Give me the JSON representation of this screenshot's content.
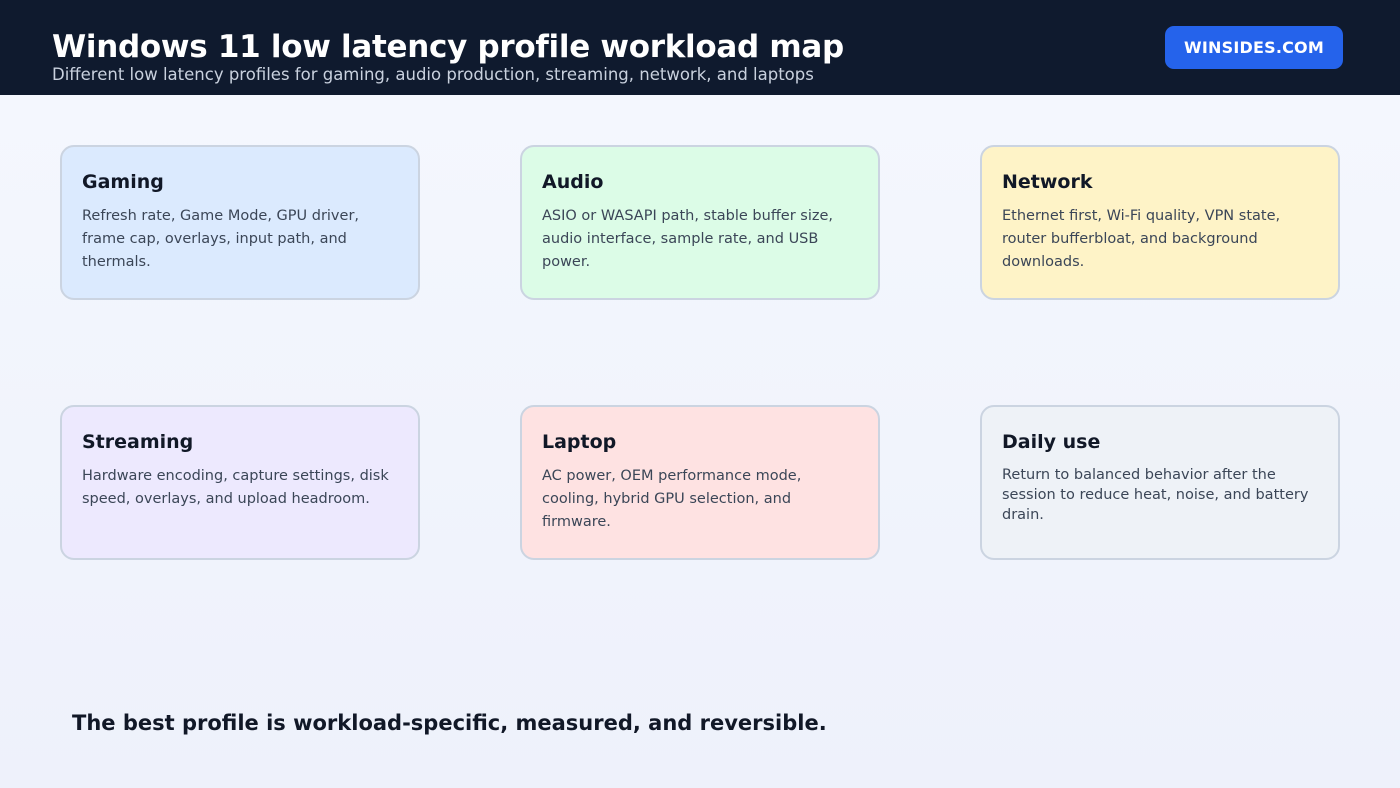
{
  "header": {
    "title": "Windows 11 low latency profile workload map",
    "subtitle": "Different low latency profiles for gaming, audio production, streaming, network, and laptops",
    "brand": "WINSIDES.COM"
  },
  "cards": [
    {
      "title": "Gaming",
      "body": "Refresh rate, Game Mode, GPU driver, frame cap, overlays, input path, and thermals.",
      "color": "#dbeafe"
    },
    {
      "title": "Audio",
      "body": "ASIO or WASAPI path, stable buffer size, audio interface, sample rate, and USB power.",
      "color": "#dcfce7"
    },
    {
      "title": "Network",
      "body": "Ethernet first, Wi-Fi quality, VPN state, router bufferbloat, and background downloads.",
      "color": "#fef3c7"
    },
    {
      "title": "Streaming",
      "body": "Hardware encoding, capture settings, disk speed, overlays, and upload headroom.",
      "color": "#ede9fe"
    },
    {
      "title": "Laptop",
      "body": "AC power, OEM performance mode, cooling, hybrid GPU selection, and firmware.",
      "color": "#fee2e2"
    },
    {
      "title": "Daily use",
      "body": "Return to balanced behavior after the session to reduce heat, noise, and battery drain.",
      "color": "#eef2f7"
    }
  ],
  "footer": {
    "note": "The best profile is workload-specific, measured, and reversible."
  },
  "colors": {
    "header_bg": "#0f1a2e",
    "brand_bg": "#2563eb",
    "card_border": "#cbd4e1"
  }
}
